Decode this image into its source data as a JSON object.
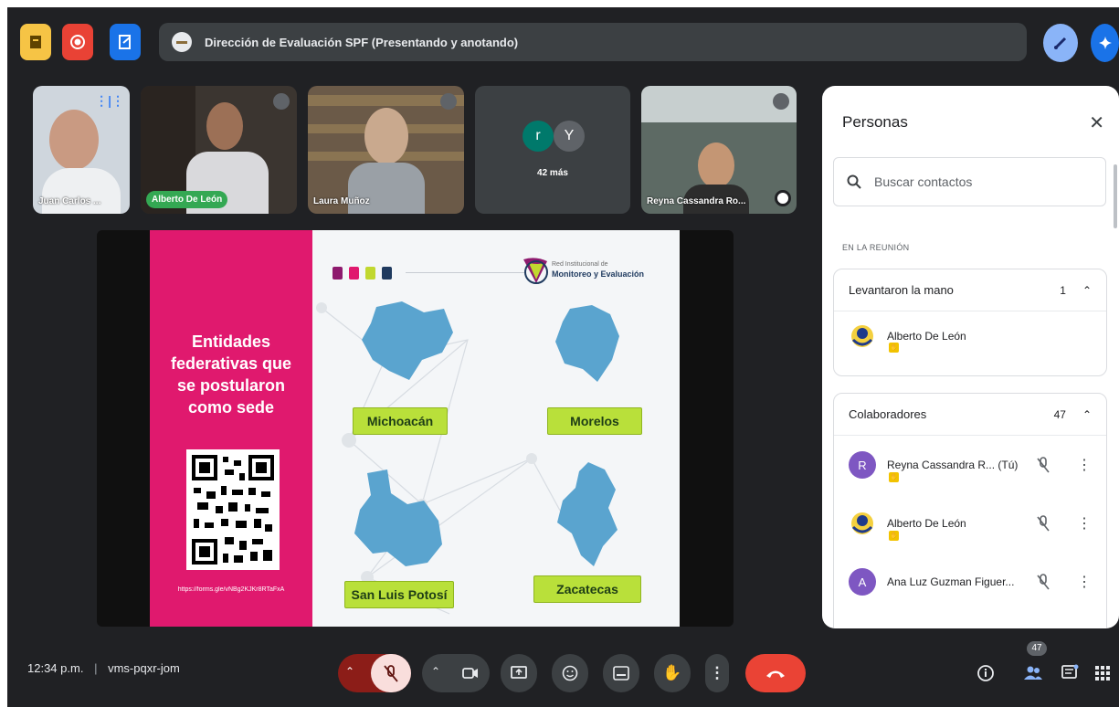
{
  "meeting": {
    "title": "Dirección de Evaluación SPF (Presentando y anotando)",
    "time": "12:34 p.m.",
    "separator": "|",
    "code": "vms-pqxr-jom"
  },
  "participants_tiles": [
    {
      "name": "Juan Carlos ..."
    },
    {
      "name": "Alberto De León"
    },
    {
      "name": "Laura Muñoz"
    },
    {
      "name": "42 más",
      "avatars": [
        "r",
        "Y"
      ]
    },
    {
      "name": "Reyna Cassandra Ro..."
    }
  ],
  "slide": {
    "title_lines": [
      "Entidades",
      "federativas que",
      "se postularon",
      "como sede"
    ],
    "url": "https://forms.gle/vNBg2KJKr8RTaFxA",
    "logo_text": [
      "Red Institucional de",
      "Monitoreo y Evaluación"
    ],
    "states": [
      "Michoacán",
      "Morelos",
      "San Luis Potosí",
      "Zacatecas"
    ],
    "dot_colors": [
      "#8e1a6e",
      "#e0196e",
      "#c1d82f",
      "#1f3a5f"
    ]
  },
  "people_panel": {
    "title": "Personas",
    "search_placeholder": "Buscar contactos",
    "section_label": "EN LA REUNIÓN",
    "raised_hand": {
      "label": "Levantaron la mano",
      "count": "1",
      "people": [
        {
          "name": "Alberto De León"
        }
      ]
    },
    "collaborators": {
      "label": "Colaboradores",
      "count": "47",
      "people": [
        {
          "name": "Reyna Cassandra R... (Tú)",
          "avatar": "R",
          "color": "#7e57c2"
        },
        {
          "name": "Alberto De León",
          "avatar": "",
          "color": "#ffffff"
        },
        {
          "name": "Ana Luz Guzman Figuer...",
          "avatar": "A",
          "color": "#7e57c2"
        }
      ]
    }
  },
  "toolbar": {
    "people_count": "47"
  },
  "colors": {
    "background": "#202124",
    "end_call": "#ea4335",
    "mic_off": "#f9dedc",
    "slide_pink": "#e0196e",
    "state_label": "#b9e03a"
  }
}
